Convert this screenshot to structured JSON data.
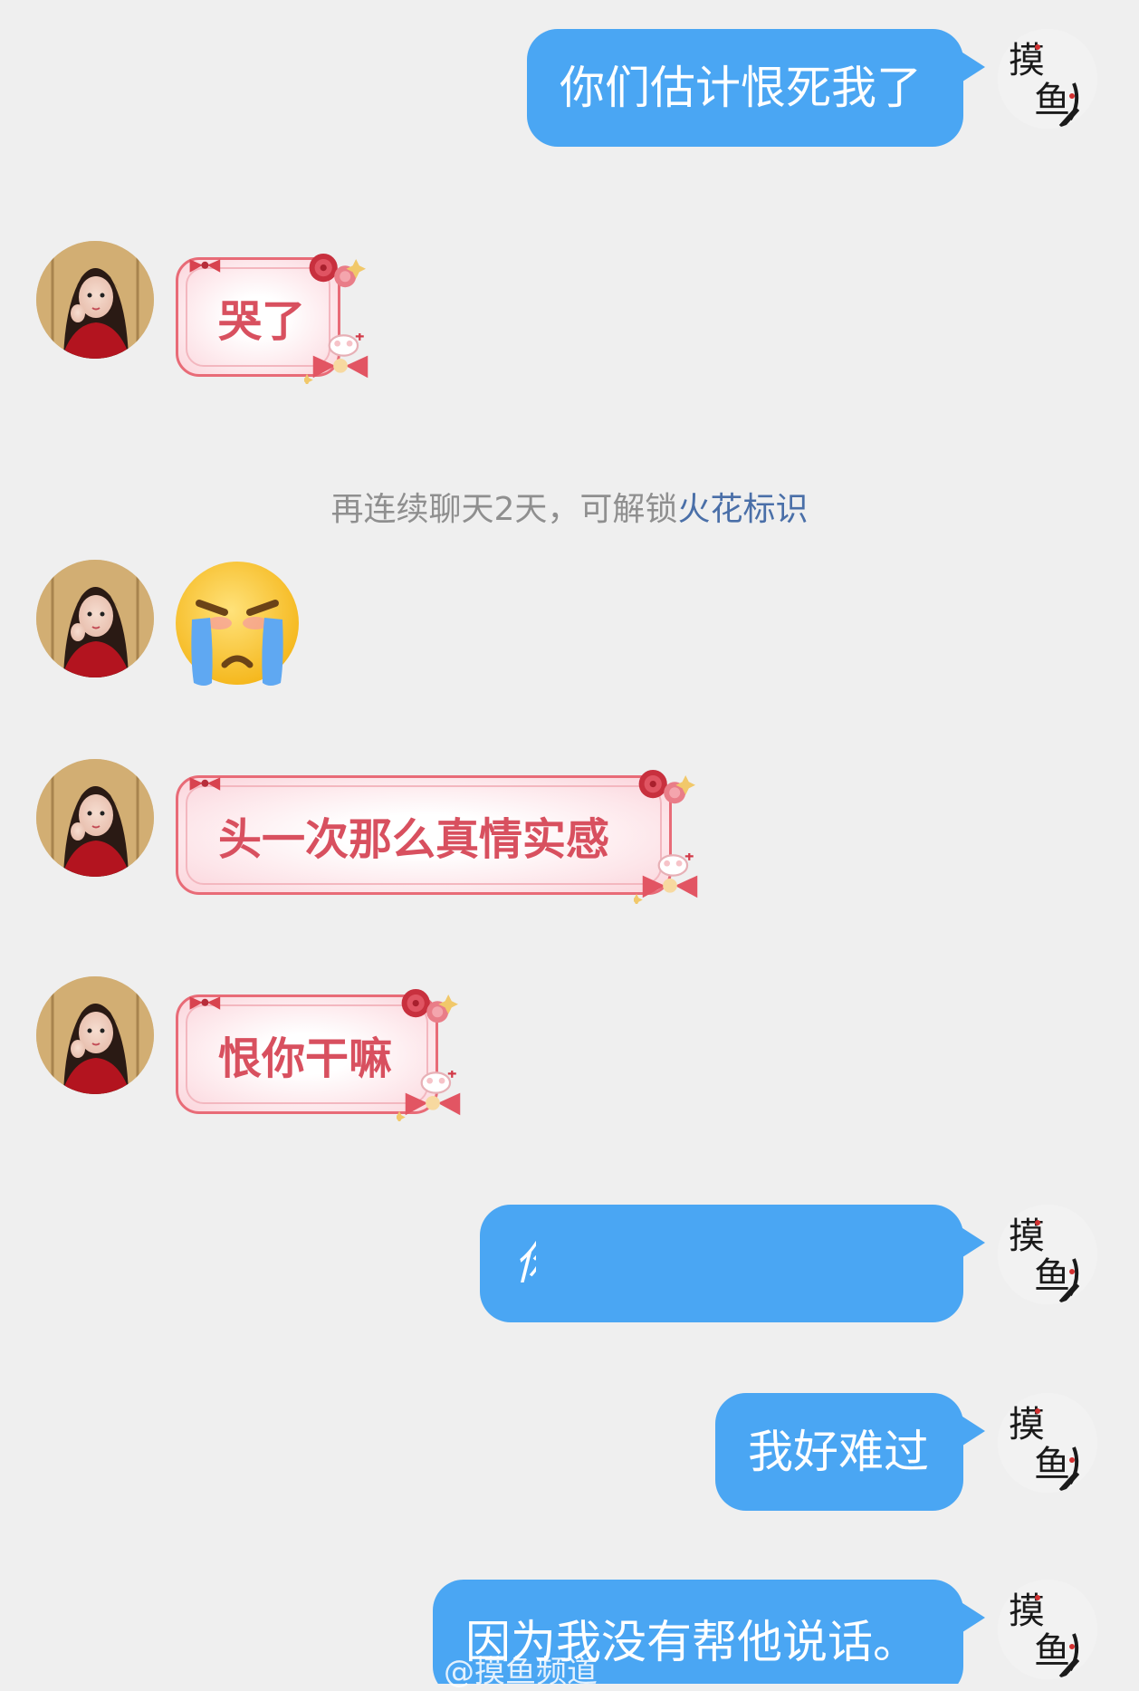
{
  "messages": [
    {
      "side": "out",
      "text": "你们估计恨死我了"
    },
    {
      "side": "in",
      "text": "哭了"
    },
    {
      "side": "in",
      "emoji": "crying-face"
    },
    {
      "side": "in",
      "text": "头一次那么真情实感"
    },
    {
      "side": "in",
      "text": "恨你干嘛"
    },
    {
      "side": "out",
      "text": "你"
    },
    {
      "side": "out",
      "text": "我好难过"
    },
    {
      "side": "out",
      "text": "因为我没有帮他说话。"
    }
  ],
  "system_notice": {
    "prefix": "再连续聊天2天，可解锁",
    "link": "火花标识"
  },
  "self_avatar": {
    "logo_text": "摸鱼"
  },
  "watermark": "@摸鱼频道",
  "colors": {
    "out_bubble": "#4aa6f3",
    "in_bubble_border": "#e86b77",
    "in_text": "#d8505f",
    "page_bg": "#efefef",
    "notice_link": "#4a6fa8"
  }
}
